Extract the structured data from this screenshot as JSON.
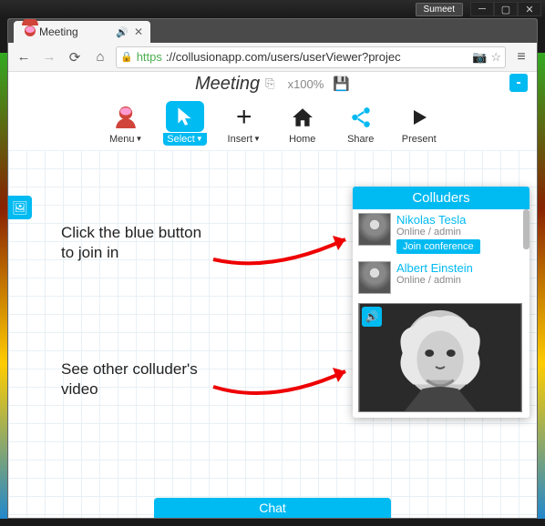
{
  "window": {
    "profile_label": "Sumeet"
  },
  "browser": {
    "tab_title": "Meeting",
    "url_https": "https",
    "url_rest": "://collusionapp.com/users/userViewer?projec"
  },
  "app": {
    "title": "Meeting",
    "zoom_label": "x100%",
    "minimize_panel": "-"
  },
  "toolbar": {
    "menu": "Menu",
    "select": "Select",
    "insert": "Insert",
    "home": "Home",
    "share": "Share",
    "present": "Present"
  },
  "annotations": {
    "join_text": "Click the blue button to join in",
    "video_text": "See other colluder's video"
  },
  "panel": {
    "title": "Colluders",
    "items": [
      {
        "name": "Nikolas Tesla",
        "status": "Online / admin",
        "join_label": "Join conference"
      },
      {
        "name": "Albert Einstein",
        "status": "Online / admin"
      }
    ]
  },
  "chat": {
    "label": "Chat"
  }
}
